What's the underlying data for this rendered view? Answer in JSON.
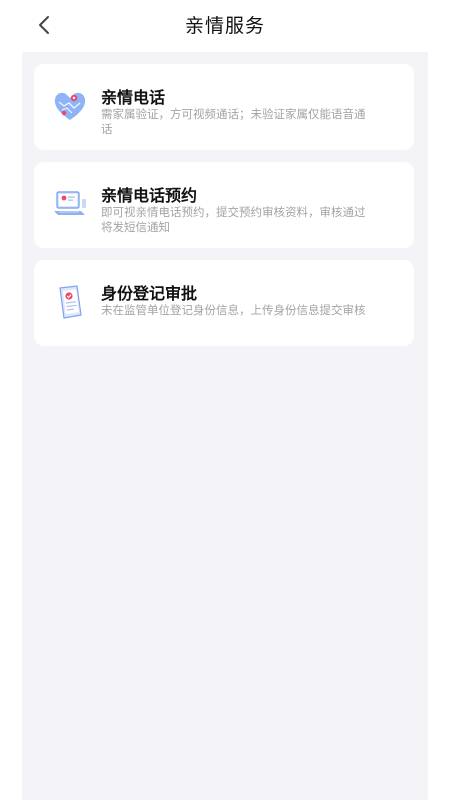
{
  "header": {
    "title": "亲情服务",
    "back_icon": "chevron-left-icon"
  },
  "services": [
    {
      "title": "亲情电话",
      "description": "需家属验证，方可视频通话；未验证家属仅能语音通话",
      "icon": "heart-map-icon"
    },
    {
      "title": "亲情电话预约",
      "description": "即可视亲情电话预约，提交预约审核资料，审核通过将发短信通知",
      "icon": "laptop-appointment-icon"
    },
    {
      "title": "身份登记审批",
      "description": "未在监管单位登记身份信息，上传身份信息提交审核",
      "icon": "document-badge-icon"
    }
  ],
  "colors": {
    "background": "#f4f4f8",
    "card": "#ffffff",
    "title_text": "#111111",
    "description_text": "#a3a3a3",
    "icon_blue": "#5b8ff0",
    "icon_red": "#f0476b"
  }
}
